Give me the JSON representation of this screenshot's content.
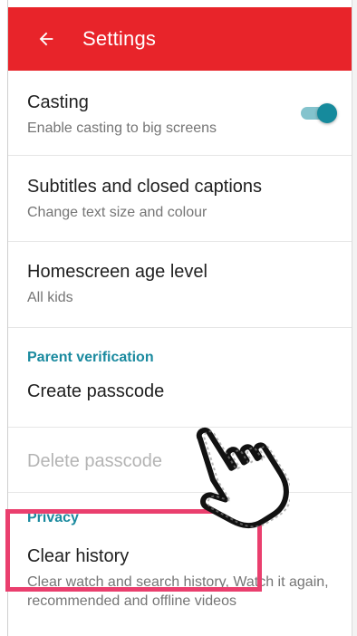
{
  "appbar": {
    "title": "Settings",
    "back_icon": "arrow-back-icon"
  },
  "settings": {
    "casting": {
      "title": "Casting",
      "subtitle": "Enable casting to big screens",
      "enabled": true
    },
    "subtitles": {
      "title": "Subtitles and closed captions",
      "subtitle": "Change text size and colour"
    },
    "age_level": {
      "title": "Homescreen age level",
      "subtitle": "All kids"
    },
    "parent_verification": {
      "header": "Parent verification",
      "create": "Create passcode",
      "delete": "Delete passcode"
    },
    "privacy": {
      "header": "Privacy",
      "clear_history": "Clear history",
      "clear_history_desc": "Clear watch and search history, Watch it again, recommended and offline videos"
    }
  },
  "colors": {
    "appbar": "#e8242a",
    "accent": "#1a8a9f",
    "highlight": "#ea3f6e"
  },
  "overlay": {
    "pointer_icon": "hand-pointer-icon"
  }
}
